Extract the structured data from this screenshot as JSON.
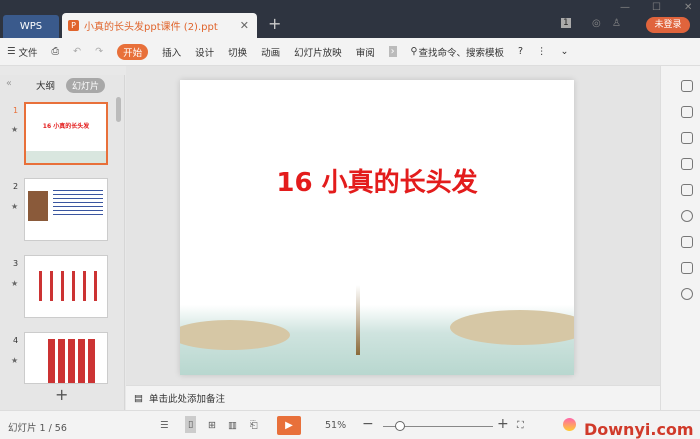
{
  "titlebar": {
    "app_tab": "WPS",
    "doc_tab": "小真的长头发ppt课件 (2).ppt",
    "login": "未登录",
    "badge": "1"
  },
  "toolbar": {
    "file": "文件",
    "items": [
      "开始",
      "插入",
      "设计",
      "切换",
      "动画",
      "幻灯片放映",
      "审阅"
    ],
    "search": "查找命令、搜索模板",
    "help": "?"
  },
  "left": {
    "outline_tab": "大纲",
    "slides_tab": "幻灯片",
    "thumb1_title": "16 小真的长头发",
    "numbers": [
      "1",
      "2",
      "3",
      "4"
    ],
    "add": "+"
  },
  "slide": {
    "title": "16 小真的长头发"
  },
  "notes": {
    "placeholder": "单击此处添加备注"
  },
  "status": {
    "slide_counter": "幻灯片 1 / 56",
    "zoom": "51%",
    "watermark": "Downyi.com",
    "zoom_progress": 0.15
  }
}
